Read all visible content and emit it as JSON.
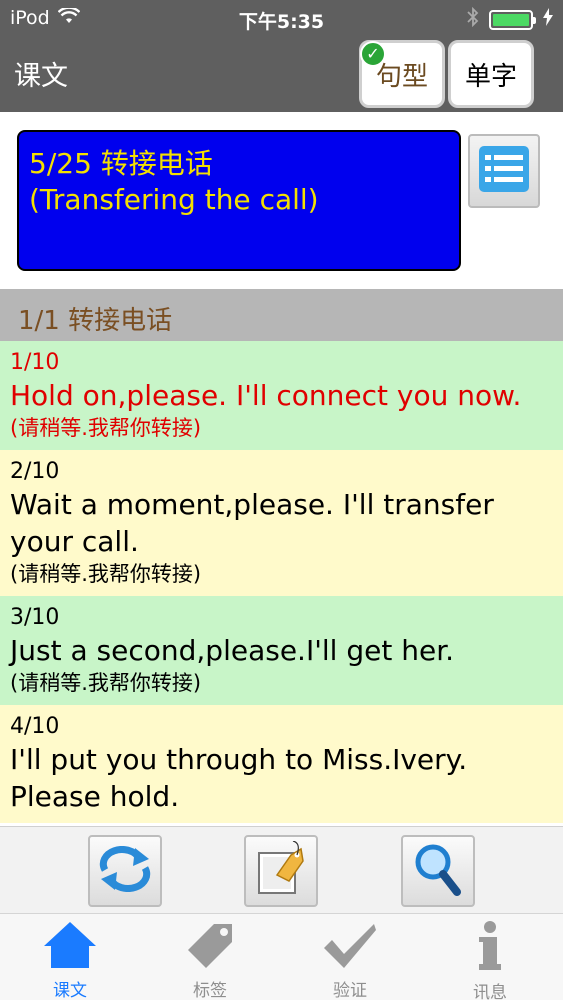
{
  "status": {
    "carrier": "iPod",
    "time": "下午5:35"
  },
  "nav": {
    "title": "课文",
    "sentence_button": "句型",
    "word_button": "单字"
  },
  "lesson": {
    "title_line1": "5/25 转接电话",
    "title_line2": "(Transfering the call)"
  },
  "section": {
    "title": "1/1 转接电话"
  },
  "sentences": [
    {
      "num": "1/10",
      "en": "Hold on,please. I'll connect you now.",
      "zh": "(请稍等.我帮你转接)"
    },
    {
      "num": "2/10",
      "en": "Wait a moment,please. I'll transfer your call.",
      "zh": "(请稍等.我帮你转接)"
    },
    {
      "num": "3/10",
      "en": "Just a second,please.I'll get her.",
      "zh": "(请稍等.我帮你转接)"
    },
    {
      "num": "4/10",
      "en": "I'll put you through to Miss.Ivery. Please hold.",
      "zh": ""
    }
  ],
  "toolbar": {
    "icons": [
      "repeat-icon",
      "bookmark-tag-icon",
      "search-icon"
    ]
  },
  "tabs": [
    {
      "label": "课文",
      "icon": "home-icon"
    },
    {
      "label": "标签",
      "icon": "tag-icon"
    },
    {
      "label": "验证",
      "icon": "checkmark-icon"
    },
    {
      "label": "讯息",
      "icon": "info-icon"
    }
  ],
  "colors": {
    "nav_bg": "#5f5f5f",
    "lesson_bg": "#0000ee",
    "lesson_text": "#f4e000",
    "active_sentence": "#e00000",
    "row_green": "#c8f5c8",
    "row_yellow": "#fffacb",
    "tab_active": "#1a7bff"
  }
}
